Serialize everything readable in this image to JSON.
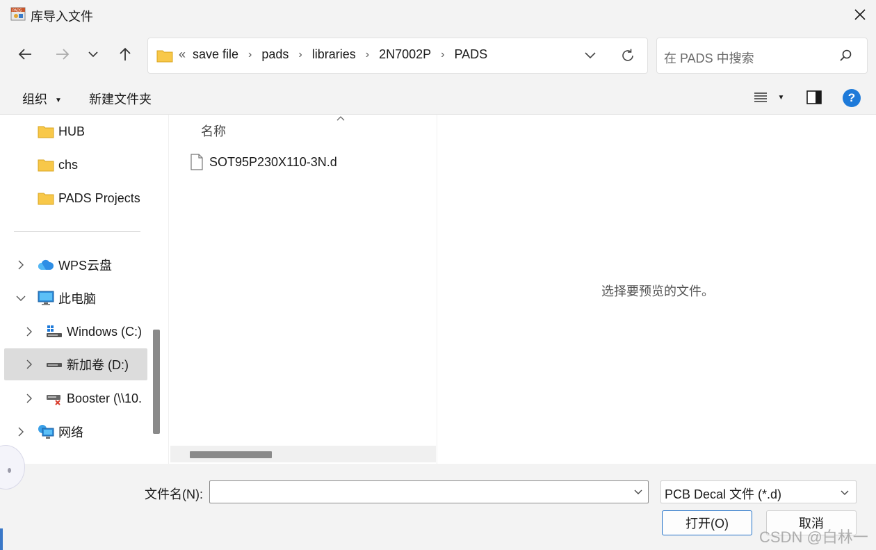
{
  "window": {
    "title": "库导入文件",
    "app_icon": "pads-app-icon",
    "close_icon": "close-icon"
  },
  "nav": {
    "back_icon": "arrow-left-icon",
    "forward_icon": "arrow-right-icon",
    "recent_icon": "chevron-down-icon",
    "up_icon": "arrow-up-icon",
    "overflow": "«",
    "breadcrumbs": [
      "save file",
      "pads",
      "libraries",
      "2N7002P",
      "PADS"
    ],
    "search_placeholder": "在 PADS 中搜索"
  },
  "toolbar": {
    "organize": "组织",
    "new_folder": "新建文件夹"
  },
  "sidebar": {
    "items": [
      {
        "label": "HUB",
        "icon": "folder-icon"
      },
      {
        "label": "chs",
        "icon": "folder-icon"
      },
      {
        "label": "PADS Projects",
        "icon": "folder-icon"
      },
      {
        "label": "WPS云盘",
        "icon": "cloud-icon"
      },
      {
        "label": "此电脑",
        "icon": "computer-icon"
      },
      {
        "label": "Windows (C:)",
        "icon": "windows-drive-icon"
      },
      {
        "label": "新加卷 (D:)",
        "icon": "drive-icon"
      },
      {
        "label": "Booster (\\\\10.",
        "icon": "network-drive-icon"
      },
      {
        "label": "网络",
        "icon": "network-icon"
      }
    ]
  },
  "files": {
    "column_name": "名称",
    "items": [
      {
        "name": "SOT95P230X110-3N.d",
        "icon": "file-icon"
      }
    ]
  },
  "preview": {
    "message": "选择要预览的文件。"
  },
  "bottom": {
    "filename_label": "文件名(N):",
    "filename_value": "",
    "filetype": "PCB Decal 文件 (*.d)",
    "open_button": "打开(O)",
    "cancel_button": "取消",
    "watermark": "CSDN @白林一"
  },
  "colors": {
    "accent": "#1e7ad9",
    "folder": "#f8c849",
    "chrome_bg": "#f3f3f3",
    "selection": "#dcdcdc"
  }
}
